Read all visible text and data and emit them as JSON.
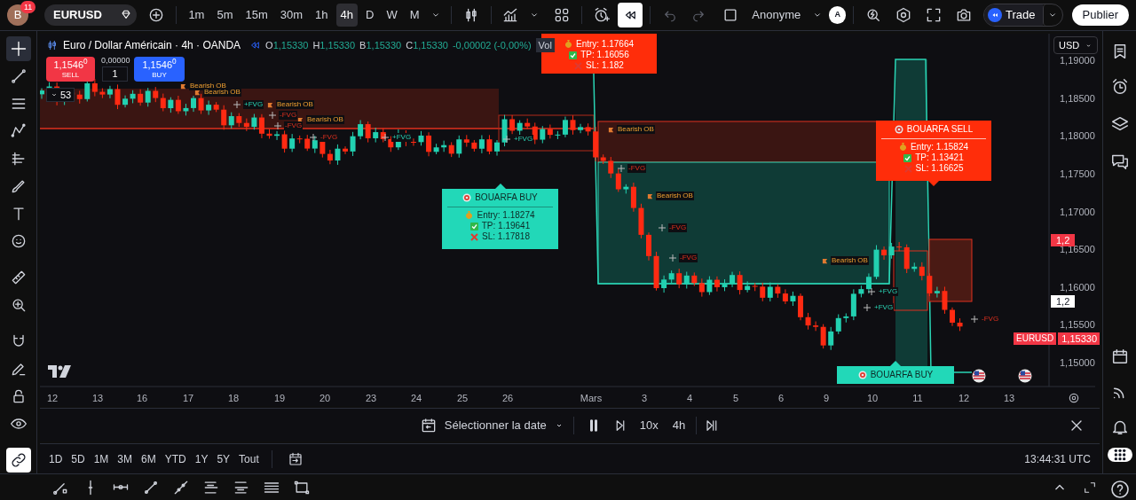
{
  "top_bar": {
    "avatar": "B",
    "notifications": "11",
    "symbol": "EURUSD",
    "intervals": [
      {
        "label": "1m",
        "selected": false
      },
      {
        "label": "5m",
        "selected": false
      },
      {
        "label": "15m",
        "selected": false
      },
      {
        "label": "30m",
        "selected": false
      },
      {
        "label": "1h",
        "selected": false
      },
      {
        "label": "4h",
        "selected": true
      },
      {
        "label": "D",
        "selected": false
      },
      {
        "label": "W",
        "selected": false
      },
      {
        "label": "M",
        "selected": false
      }
    ],
    "replay_active": true,
    "layout_name": "Anonyme",
    "user_initial": "A",
    "trade_button": "Trade",
    "publish_button": "Publier"
  },
  "left_toolbar": {
    "tools": [
      {
        "kind": "crosshair",
        "selected": true
      },
      {
        "kind": "trend",
        "selected": false
      },
      {
        "kind": "fib",
        "selected": false
      },
      {
        "kind": "pattern",
        "selected": false
      },
      {
        "kind": "gann",
        "selected": false
      },
      {
        "kind": "brush",
        "selected": false
      },
      {
        "kind": "text",
        "selected": false
      },
      {
        "kind": "smiley",
        "selected": false
      },
      {
        "kind": "ruler",
        "selected": false
      },
      {
        "kind": "zoom",
        "selected": false
      },
      {
        "kind": "magnet",
        "selected": false
      },
      {
        "kind": "pencil",
        "selected": false
      },
      {
        "kind": "lock",
        "selected": false
      },
      {
        "kind": "eye",
        "selected": false
      },
      {
        "kind": "link",
        "selected": true
      }
    ]
  },
  "chart": {
    "title": "Euro / Dollar Américain · 4h · OANDA",
    "ohlc": [
      {
        "key": "O",
        "value": "1,15330"
      },
      {
        "key": "H",
        "value": "1,15330"
      },
      {
        "key": "B",
        "value": "1,15330"
      },
      {
        "key": "C",
        "value": "1,15330"
      }
    ],
    "change": "-0,00002 (-0,00%)",
    "volume_label": "Vol",
    "sell_price": "1,1546$^{0}$",
    "sell_label": "SELL",
    "spread": "0,00000",
    "quantity": "1",
    "buy_price": "1,1546$^{0}$",
    "buy_label": "BUY",
    "collapsed_count": "53",
    "currency": "USD",
    "price_ticks": [
      "1,19000",
      "1,18500",
      "1,18000",
      "1,17500",
      "1,17000",
      "1,16500",
      "1,16000",
      "1,15500",
      "1,15000"
    ],
    "price_badges": [
      {
        "kind": "alert",
        "text": "1,2"
      },
      {
        "kind": "plain",
        "text": "1,2"
      },
      {
        "kind": "symbol",
        "symbol": "EURUSD",
        "text": "1,15330"
      }
    ],
    "time_ticks": [
      "12",
      "13",
      "16",
      "17",
      "18",
      "19",
      "20",
      "23",
      "24",
      "25",
      "26",
      "Mars",
      "3",
      "4",
      "5",
      "6",
      "9",
      "10",
      "11",
      "12",
      "13"
    ],
    "markers": [
      {
        "kind": "bearish_ob",
        "text": "Bearish OB"
      },
      {
        "kind": "bearish_ob",
        "text": "Bearish OB"
      },
      {
        "kind": "bearish_ob",
        "text": "Bearish OB"
      },
      {
        "kind": "bearish_ob",
        "text": "Bearish OB"
      },
      {
        "kind": "bearish_ob",
        "text": "Bearish OB"
      },
      {
        "kind": "bearish_ob",
        "text": "Bearish OB"
      },
      {
        "kind": "bearish_ob",
        "text": "Bearish OB"
      },
      {
        "kind": "plus_fvg",
        "text": "+FVG"
      },
      {
        "kind": "minus_fvg",
        "text": "-FVG"
      },
      {
        "kind": "minus_fvg",
        "text": "-FVG"
      },
      {
        "kind": "minus_fvg",
        "text": "-FVG"
      },
      {
        "kind": "plus_fvg",
        "text": "+FVG"
      },
      {
        "kind": "minus_fvg",
        "text": "-FVG"
      },
      {
        "kind": "minus_fvg",
        "text": "-FVG"
      },
      {
        "kind": "minus_fvg",
        "text": "-FVG"
      },
      {
        "kind": "plus_fvg",
        "text": "+FVG"
      },
      {
        "kind": "plus_fvg",
        "text": "+FVG"
      },
      {
        "kind": "minus_fvg",
        "text": "-FVG"
      },
      {
        "kind": "plus_fvg",
        "text": "+FVG"
      }
    ],
    "signals": [
      {
        "kind": "sell",
        "lines": [
          {
            "kind": "entry",
            "text": "Entry: 1.17664"
          },
          {
            "kind": "tp",
            "text": "TP: 1.16056"
          },
          {
            "kind": "sl",
            "text": "SL: 1.182"
          }
        ]
      },
      {
        "kind": "buy",
        "title": "BOUARFA BUY",
        "lines": [
          {
            "kind": "entry",
            "text": "Entry: 1.18274"
          },
          {
            "kind": "tp",
            "text": "TP: 1.19641"
          },
          {
            "kind": "sl",
            "text": "SL: 1.17818"
          }
        ]
      },
      {
        "kind": "sell",
        "title": "BOUARFA SELL",
        "lines": [
          {
            "kind": "entry",
            "text": "Entry: 1.15824"
          },
          {
            "kind": "tp",
            "text": "TP: 1.13421"
          },
          {
            "kind": "sl",
            "text": "SL: 1.16625"
          }
        ]
      },
      {
        "kind": "buy",
        "title": "BOUARFA BUY"
      }
    ]
  },
  "replay_bar": {
    "date_button": "Sélectionner la date",
    "speed": "10x",
    "interval": "4h"
  },
  "range_bar": {
    "ranges": [
      "1D",
      "5D",
      "1M",
      "3M",
      "6M",
      "YTD",
      "1Y",
      "5Y",
      "Tout"
    ],
    "clock": "13:44:31 UTC"
  }
}
